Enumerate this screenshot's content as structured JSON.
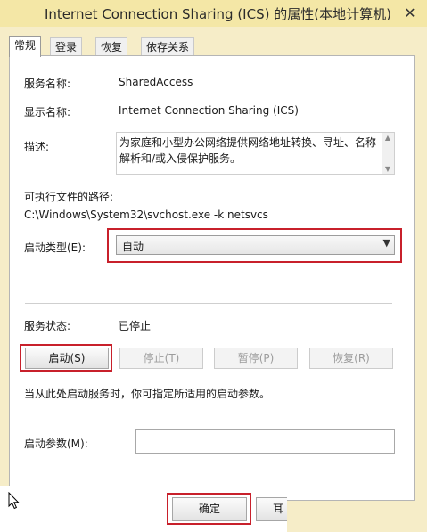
{
  "window": {
    "title": "Internet Connection Sharing (ICS) 的属性(本地计算机)",
    "close_glyph": "✕"
  },
  "tabs": [
    {
      "label": "常规",
      "active": true
    },
    {
      "label": "登录",
      "active": false
    },
    {
      "label": "恢复",
      "active": false
    },
    {
      "label": "依存关系",
      "active": false
    }
  ],
  "general": {
    "service_name_label": "服务名称:",
    "service_name": "SharedAccess",
    "display_name_label": "显示名称:",
    "display_name": "Internet Connection Sharing (ICS)",
    "description_label": "描述:",
    "description": "为家庭和小型办公网络提供网络地址转换、寻址、名称解析和/或入侵保护服务。",
    "exe_path_label": "可执行文件的路径:",
    "exe_path": "C:\\Windows\\System32\\svchost.exe -k netsvcs",
    "startup_type_label": "启动类型(E):",
    "startup_type": "自动",
    "service_status_label": "服务状态:",
    "service_status": "已停止",
    "buttons": {
      "start": "启动(S)",
      "stop": "停止(T)",
      "pause": "暂停(P)",
      "resume": "恢复(R)"
    },
    "hint": "当从此处启动服务时，你可指定所适用的启动参数。",
    "start_params_label": "启动参数(M):",
    "start_params_value": ""
  },
  "footer": {
    "ok": "确定",
    "cancel_partial": "耳"
  },
  "icons": {
    "dropdown_arrow": "chevron-down-icon",
    "scroll_up": "scroll-up-icon",
    "scroll_down": "scroll-down-icon",
    "cursor": "mouse-cursor-icon",
    "close": "close-icon"
  },
  "colors": {
    "titlebar": "#f4e7a6",
    "frame": "#f6edc8",
    "highlight": "#c8202b"
  }
}
